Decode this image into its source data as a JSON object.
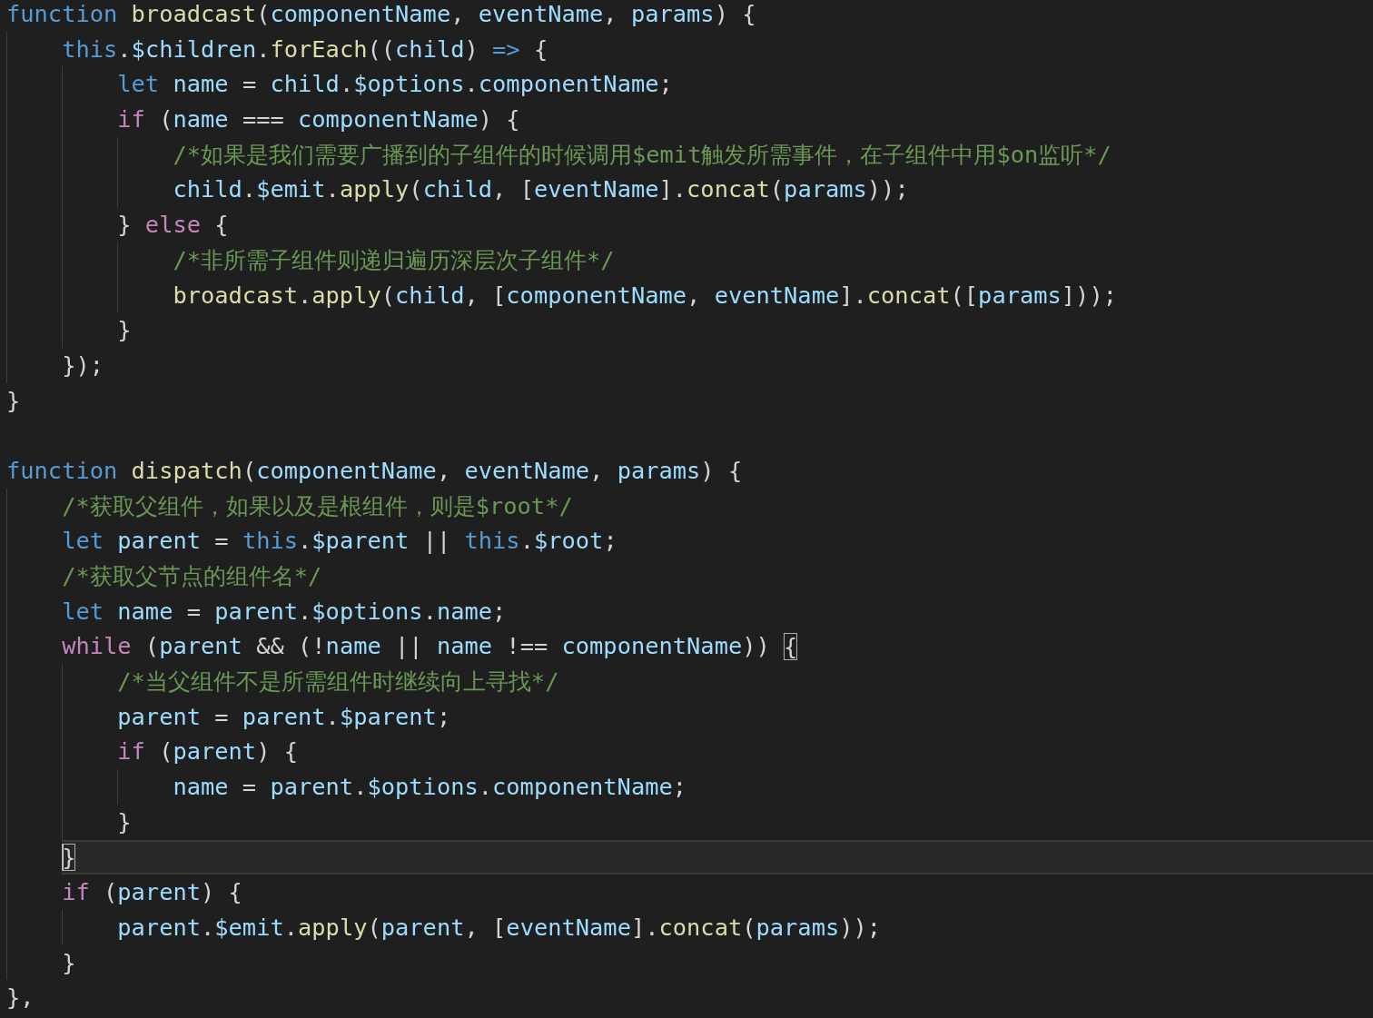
{
  "editor": {
    "lines": [
      {
        "kind": "code",
        "current": false,
        "tokens": [
          {
            "kind": "keyword",
            "text": "function "
          },
          {
            "kind": "function",
            "text": "broadcast"
          },
          {
            "kind": "plain",
            "text": "("
          },
          {
            "kind": "variable",
            "text": "componentName"
          },
          {
            "kind": "plain",
            "text": ", "
          },
          {
            "kind": "variable",
            "text": "eventName"
          },
          {
            "kind": "plain",
            "text": ", "
          },
          {
            "kind": "variable",
            "text": "params"
          },
          {
            "kind": "plain",
            "text": ") {"
          }
        ],
        "children": [
          {
            "kind": "code",
            "current": false,
            "tokens": [
              {
                "kind": "keyword",
                "text": "this"
              },
              {
                "kind": "plain",
                "text": "."
              },
              {
                "kind": "variable",
                "text": "$children"
              },
              {
                "kind": "plain",
                "text": "."
              },
              {
                "kind": "function",
                "text": "forEach"
              },
              {
                "kind": "plain",
                "text": "(("
              },
              {
                "kind": "variable",
                "text": "child"
              },
              {
                "kind": "plain",
                "text": ") "
              },
              {
                "kind": "keyword",
                "text": "=>"
              },
              {
                "kind": "plain",
                "text": " {"
              }
            ],
            "children": [
              {
                "kind": "code",
                "current": false,
                "tokens": [
                  {
                    "kind": "keyword",
                    "text": "let "
                  },
                  {
                    "kind": "variable",
                    "text": "name"
                  },
                  {
                    "kind": "plain",
                    "text": " = "
                  },
                  {
                    "kind": "variable",
                    "text": "child"
                  },
                  {
                    "kind": "plain",
                    "text": "."
                  },
                  {
                    "kind": "variable",
                    "text": "$options"
                  },
                  {
                    "kind": "plain",
                    "text": "."
                  },
                  {
                    "kind": "variable",
                    "text": "componentName"
                  },
                  {
                    "kind": "plain",
                    "text": ";"
                  }
                ]
              },
              {
                "kind": "code",
                "current": false,
                "tokens": [
                  {
                    "kind": "control",
                    "text": "if"
                  },
                  {
                    "kind": "plain",
                    "text": " ("
                  },
                  {
                    "kind": "variable",
                    "text": "name"
                  },
                  {
                    "kind": "plain",
                    "text": " === "
                  },
                  {
                    "kind": "variable",
                    "text": "componentName"
                  },
                  {
                    "kind": "plain",
                    "text": ") {"
                  }
                ],
                "children": [
                  {
                    "kind": "code",
                    "current": false,
                    "tokens": [
                      {
                        "kind": "comment",
                        "text": "/*如果是我们需要广播到的子组件的时候调用$emit触发所需事件，在子组件中用$on监听*/"
                      }
                    ]
                  },
                  {
                    "kind": "code",
                    "current": false,
                    "tokens": [
                      {
                        "kind": "variable",
                        "text": "child"
                      },
                      {
                        "kind": "plain",
                        "text": "."
                      },
                      {
                        "kind": "variable",
                        "text": "$emit"
                      },
                      {
                        "kind": "plain",
                        "text": "."
                      },
                      {
                        "kind": "function",
                        "text": "apply"
                      },
                      {
                        "kind": "plain",
                        "text": "("
                      },
                      {
                        "kind": "variable",
                        "text": "child"
                      },
                      {
                        "kind": "plain",
                        "text": ", ["
                      },
                      {
                        "kind": "variable",
                        "text": "eventName"
                      },
                      {
                        "kind": "plain",
                        "text": "]."
                      },
                      {
                        "kind": "function",
                        "text": "concat"
                      },
                      {
                        "kind": "plain",
                        "text": "("
                      },
                      {
                        "kind": "variable",
                        "text": "params"
                      },
                      {
                        "kind": "plain",
                        "text": "));"
                      }
                    ]
                  }
                ]
              },
              {
                "kind": "code",
                "current": false,
                "tokens": [
                  {
                    "kind": "plain",
                    "text": "} "
                  },
                  {
                    "kind": "control",
                    "text": "else"
                  },
                  {
                    "kind": "plain",
                    "text": " {"
                  }
                ],
                "children": [
                  {
                    "kind": "code",
                    "current": false,
                    "tokens": [
                      {
                        "kind": "comment",
                        "text": "/*非所需子组件则递归遍历深层次子组件*/"
                      }
                    ]
                  },
                  {
                    "kind": "code",
                    "current": false,
                    "tokens": [
                      {
                        "kind": "function",
                        "text": "broadcast"
                      },
                      {
                        "kind": "plain",
                        "text": "."
                      },
                      {
                        "kind": "function",
                        "text": "apply"
                      },
                      {
                        "kind": "plain",
                        "text": "("
                      },
                      {
                        "kind": "variable",
                        "text": "child"
                      },
                      {
                        "kind": "plain",
                        "text": ", ["
                      },
                      {
                        "kind": "variable",
                        "text": "componentName"
                      },
                      {
                        "kind": "plain",
                        "text": ", "
                      },
                      {
                        "kind": "variable",
                        "text": "eventName"
                      },
                      {
                        "kind": "plain",
                        "text": "]."
                      },
                      {
                        "kind": "function",
                        "text": "concat"
                      },
                      {
                        "kind": "plain",
                        "text": "(["
                      },
                      {
                        "kind": "variable",
                        "text": "params"
                      },
                      {
                        "kind": "plain",
                        "text": "]));"
                      }
                    ]
                  }
                ]
              },
              {
                "kind": "code",
                "current": false,
                "tokens": [
                  {
                    "kind": "plain",
                    "text": "}"
                  }
                ]
              }
            ]
          },
          {
            "kind": "code",
            "current": false,
            "tokens": [
              {
                "kind": "plain",
                "text": "});"
              }
            ]
          }
        ]
      },
      {
        "kind": "code",
        "current": false,
        "tokens": [
          {
            "kind": "plain",
            "text": "}"
          }
        ]
      },
      {
        "kind": "blank",
        "current": false
      },
      {
        "kind": "code",
        "current": false,
        "tokens": [
          {
            "kind": "keyword",
            "text": "function "
          },
          {
            "kind": "function",
            "text": "dispatch"
          },
          {
            "kind": "plain",
            "text": "("
          },
          {
            "kind": "variable",
            "text": "componentName"
          },
          {
            "kind": "plain",
            "text": ", "
          },
          {
            "kind": "variable",
            "text": "eventName"
          },
          {
            "kind": "plain",
            "text": ", "
          },
          {
            "kind": "variable",
            "text": "params"
          },
          {
            "kind": "plain",
            "text": ") {"
          }
        ],
        "children": [
          {
            "kind": "code",
            "current": false,
            "tokens": [
              {
                "kind": "comment",
                "text": "/*获取父组件，如果以及是根组件，则是$root*/"
              }
            ]
          },
          {
            "kind": "code",
            "current": false,
            "tokens": [
              {
                "kind": "keyword",
                "text": "let "
              },
              {
                "kind": "variable",
                "text": "parent"
              },
              {
                "kind": "plain",
                "text": " = "
              },
              {
                "kind": "keyword",
                "text": "this"
              },
              {
                "kind": "plain",
                "text": "."
              },
              {
                "kind": "variable",
                "text": "$parent"
              },
              {
                "kind": "plain",
                "text": " || "
              },
              {
                "kind": "keyword",
                "text": "this"
              },
              {
                "kind": "plain",
                "text": "."
              },
              {
                "kind": "variable",
                "text": "$root"
              },
              {
                "kind": "plain",
                "text": ";"
              }
            ]
          },
          {
            "kind": "code",
            "current": false,
            "tokens": [
              {
                "kind": "comment",
                "text": "/*获取父节点的组件名*/"
              }
            ]
          },
          {
            "kind": "code",
            "current": false,
            "tokens": [
              {
                "kind": "keyword",
                "text": "let "
              },
              {
                "kind": "variable",
                "text": "name"
              },
              {
                "kind": "plain",
                "text": " = "
              },
              {
                "kind": "variable",
                "text": "parent"
              },
              {
                "kind": "plain",
                "text": "."
              },
              {
                "kind": "variable",
                "text": "$options"
              },
              {
                "kind": "plain",
                "text": "."
              },
              {
                "kind": "variable",
                "text": "name"
              },
              {
                "kind": "plain",
                "text": ";"
              }
            ]
          },
          {
            "kind": "code",
            "current": false,
            "tokens": [
              {
                "kind": "control",
                "text": "while"
              },
              {
                "kind": "plain",
                "text": " ("
              },
              {
                "kind": "variable",
                "text": "parent"
              },
              {
                "kind": "plain",
                "text": " && (!"
              },
              {
                "kind": "variable",
                "text": "name"
              },
              {
                "kind": "plain",
                "text": " || "
              },
              {
                "kind": "variable",
                "text": "name"
              },
              {
                "kind": "plain",
                "text": " !== "
              },
              {
                "kind": "variable",
                "text": "componentName"
              },
              {
                "kind": "plain",
                "text": ")) "
              },
              {
                "kind": "bracket",
                "text": "{",
                "matched": true
              }
            ],
            "children": [
              {
                "kind": "code",
                "current": false,
                "tokens": [
                  {
                    "kind": "comment",
                    "text": "/*当父组件不是所需组件时继续向上寻找*/"
                  }
                ]
              },
              {
                "kind": "code",
                "current": false,
                "tokens": [
                  {
                    "kind": "variable",
                    "text": "parent"
                  },
                  {
                    "kind": "plain",
                    "text": " = "
                  },
                  {
                    "kind": "variable",
                    "text": "parent"
                  },
                  {
                    "kind": "plain",
                    "text": "."
                  },
                  {
                    "kind": "variable",
                    "text": "$parent"
                  },
                  {
                    "kind": "plain",
                    "text": ";"
                  }
                ]
              },
              {
                "kind": "code",
                "current": false,
                "tokens": [
                  {
                    "kind": "control",
                    "text": "if"
                  },
                  {
                    "kind": "plain",
                    "text": " ("
                  },
                  {
                    "kind": "variable",
                    "text": "parent"
                  },
                  {
                    "kind": "plain",
                    "text": ") {"
                  }
                ],
                "children": [
                  {
                    "kind": "code",
                    "current": false,
                    "tokens": [
                      {
                        "kind": "variable",
                        "text": "name"
                      },
                      {
                        "kind": "plain",
                        "text": " = "
                      },
                      {
                        "kind": "variable",
                        "text": "parent"
                      },
                      {
                        "kind": "plain",
                        "text": "."
                      },
                      {
                        "kind": "variable",
                        "text": "$options"
                      },
                      {
                        "kind": "plain",
                        "text": "."
                      },
                      {
                        "kind": "variable",
                        "text": "componentName"
                      },
                      {
                        "kind": "plain",
                        "text": ";"
                      }
                    ]
                  }
                ]
              },
              {
                "kind": "code",
                "current": false,
                "tokens": [
                  {
                    "kind": "plain",
                    "text": "}"
                  }
                ]
              }
            ]
          },
          {
            "kind": "code",
            "current": true,
            "tokens": [
              {
                "kind": "bracket",
                "text": "}",
                "matched": true
              }
            ]
          },
          {
            "kind": "code",
            "current": false,
            "tokens": [
              {
                "kind": "control",
                "text": "if"
              },
              {
                "kind": "plain",
                "text": " ("
              },
              {
                "kind": "variable",
                "text": "parent"
              },
              {
                "kind": "plain",
                "text": ") {"
              }
            ],
            "children": [
              {
                "kind": "code",
                "current": false,
                "tokens": [
                  {
                    "kind": "variable",
                    "text": "parent"
                  },
                  {
                    "kind": "plain",
                    "text": "."
                  },
                  {
                    "kind": "variable",
                    "text": "$emit"
                  },
                  {
                    "kind": "plain",
                    "text": "."
                  },
                  {
                    "kind": "function",
                    "text": "apply"
                  },
                  {
                    "kind": "plain",
                    "text": "("
                  },
                  {
                    "kind": "variable",
                    "text": "parent"
                  },
                  {
                    "kind": "plain",
                    "text": ", ["
                  },
                  {
                    "kind": "variable",
                    "text": "eventName"
                  },
                  {
                    "kind": "plain",
                    "text": "]."
                  },
                  {
                    "kind": "function",
                    "text": "concat"
                  },
                  {
                    "kind": "plain",
                    "text": "("
                  },
                  {
                    "kind": "variable",
                    "text": "params"
                  },
                  {
                    "kind": "plain",
                    "text": "));"
                  }
                ]
              }
            ]
          },
          {
            "kind": "code",
            "current": false,
            "tokens": [
              {
                "kind": "plain",
                "text": "}"
              }
            ]
          }
        ]
      },
      {
        "kind": "code",
        "current": false,
        "tokens": [
          {
            "kind": "plain",
            "text": "},"
          }
        ]
      }
    ]
  }
}
